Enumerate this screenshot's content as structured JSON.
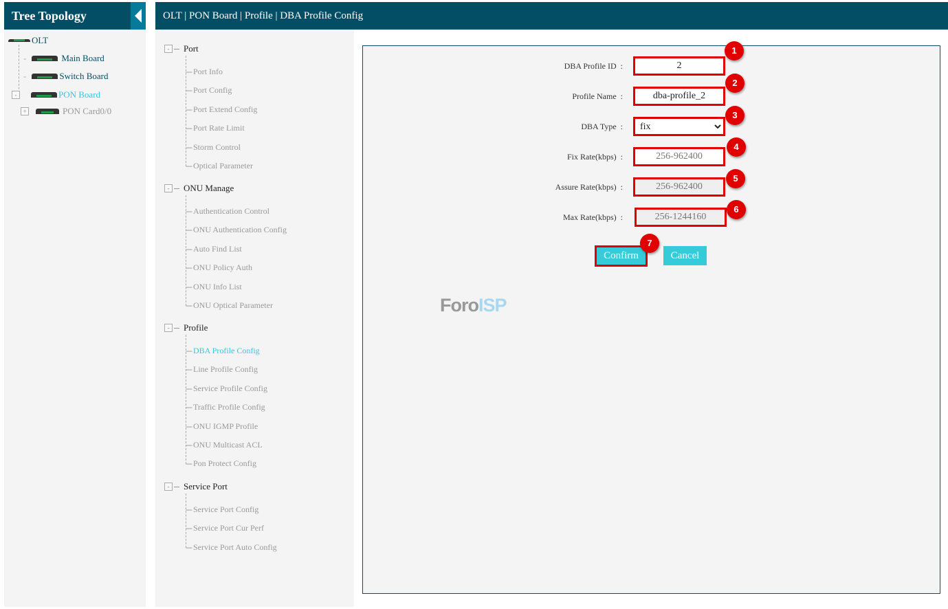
{
  "tree": {
    "title": "Tree Topology",
    "nodes": [
      {
        "label": "OLT"
      },
      {
        "label": "Main Board"
      },
      {
        "label": "Switch Board"
      },
      {
        "label": "PON Board",
        "active": true
      },
      {
        "label": "PON Card0/0"
      }
    ]
  },
  "breadcrumb": "OLT | PON Board | Profile | DBA Profile Config",
  "menu": [
    {
      "label": "Port",
      "items": [
        "Port Info",
        "Port Config",
        "Port Extend Config",
        "Port Rate Limit",
        "Storm Control",
        "Optical Parameter"
      ]
    },
    {
      "label": "ONU Manage",
      "items": [
        "Authentication Control",
        "ONU Authentication Config",
        "Auto Find List",
        "ONU Policy Auth",
        "ONU Info List",
        "ONU Optical Parameter"
      ]
    },
    {
      "label": "Profile",
      "items": [
        "DBA Profile Config",
        "Line Profile Config",
        "Service Profile Config",
        "Traffic Profile Config",
        "ONU IGMP Profile",
        "ONU Multicast ACL",
        "Pon Protect Config"
      ]
    },
    {
      "label": "Service Port",
      "items": [
        "Service Port Config",
        "Service Port Cur Perf",
        "Service Port Auto Config"
      ]
    }
  ],
  "active_menu_item": "DBA Profile Config",
  "form": {
    "profile_id": {
      "label": "DBA Profile ID",
      "value": "2"
    },
    "profile_name": {
      "label": "Profile Name",
      "value": "dba-profile_2"
    },
    "dba_type": {
      "label": "DBA Type",
      "value": "fix"
    },
    "fix_rate": {
      "label": "Fix Rate(kbps)",
      "placeholder": "256-962400"
    },
    "assure_rate": {
      "label": "Assure Rate(kbps)",
      "placeholder": "256-962400"
    },
    "max_rate": {
      "label": "Max Rate(kbps)",
      "placeholder": "256-1244160"
    },
    "confirm": "Confirm",
    "cancel": "Cancel"
  },
  "annotations": [
    "1",
    "2",
    "3",
    "4",
    "5",
    "6",
    "7"
  ],
  "watermark": {
    "a": "Foro",
    "b": "ISP"
  },
  "colors": {
    "header": "#034e64",
    "accent": "#36cbd9",
    "highlight": "#e00000"
  }
}
